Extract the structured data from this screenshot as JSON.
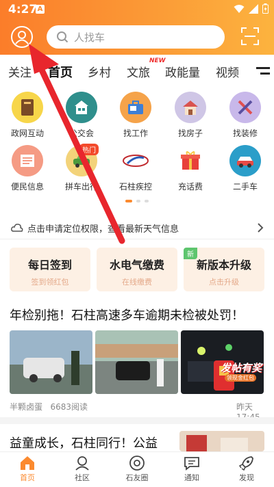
{
  "status_bar": {
    "time": "4:27",
    "notification_badge": "A"
  },
  "search": {
    "placeholder": "人找车"
  },
  "tabs": [
    {
      "label": "关注"
    },
    {
      "label": "首页",
      "active": true
    },
    {
      "label": "乡村"
    },
    {
      "label": "文旅",
      "badge": "NEW"
    },
    {
      "label": "政能量"
    },
    {
      "label": "视频"
    }
  ],
  "grid": {
    "hot_badge": "热门",
    "items": [
      {
        "label": "政网互动",
        "icon": "book-icon",
        "color": "#f7d64a"
      },
      {
        "label": "公交会",
        "icon": "bus-station-icon",
        "color": "#2f8f8c"
      },
      {
        "label": "找工作",
        "icon": "briefcase-icon",
        "color": "#f5a34a"
      },
      {
        "label": "找房子",
        "icon": "house-icon",
        "color": "#cfc6e6"
      },
      {
        "label": "找装修",
        "icon": "tools-icon",
        "color": "#c8b8ea"
      },
      {
        "label": "便民信息",
        "icon": "newspaper-icon",
        "color": "#f59b84"
      },
      {
        "label": "拼车出行",
        "icon": "carpool-icon",
        "color": "#f3d37a"
      },
      {
        "label": "石柱疾控",
        "icon": "cdc-logo-icon",
        "color": "#ffffff"
      },
      {
        "label": "充话费",
        "icon": "gift-phone-icon",
        "color": "#ffffff"
      },
      {
        "label": "二手车",
        "icon": "car-icon",
        "color": "#2b9ec9"
      }
    ]
  },
  "weather": {
    "text": "点击申请定位权限，查看最新天气信息"
  },
  "cards": [
    {
      "title": "每日签到",
      "subtitle": "签到领红包",
      "bg": "#fdf0e4"
    },
    {
      "title": "水电气缴费",
      "subtitle": "在线缴费",
      "bg": "#fdf0e4"
    },
    {
      "title": "新版本升级",
      "subtitle": "点击升级",
      "bg": "#fdf0e4",
      "badge": "新"
    }
  ],
  "feed": {
    "headline": "年检别拖！石柱高速多车逾期未检被处罚！",
    "author": "半颗卤蛋",
    "reads": "6683阅读",
    "time": "昨天 17:45",
    "promo_title": "发帖有奖",
    "promo_sub": "领现金红包",
    "headline2": "益童成长，石柱同行！公益"
  },
  "nav": [
    {
      "label": "首页",
      "icon": "home-icon",
      "active": true
    },
    {
      "label": "社区",
      "icon": "community-icon"
    },
    {
      "label": "石友圈",
      "icon": "moments-icon"
    },
    {
      "label": "通知",
      "icon": "notification-icon"
    },
    {
      "label": "发现",
      "icon": "rocket-icon"
    }
  ],
  "colors": {
    "accent": "#fb8a2f",
    "arrow": "#e8262d"
  }
}
